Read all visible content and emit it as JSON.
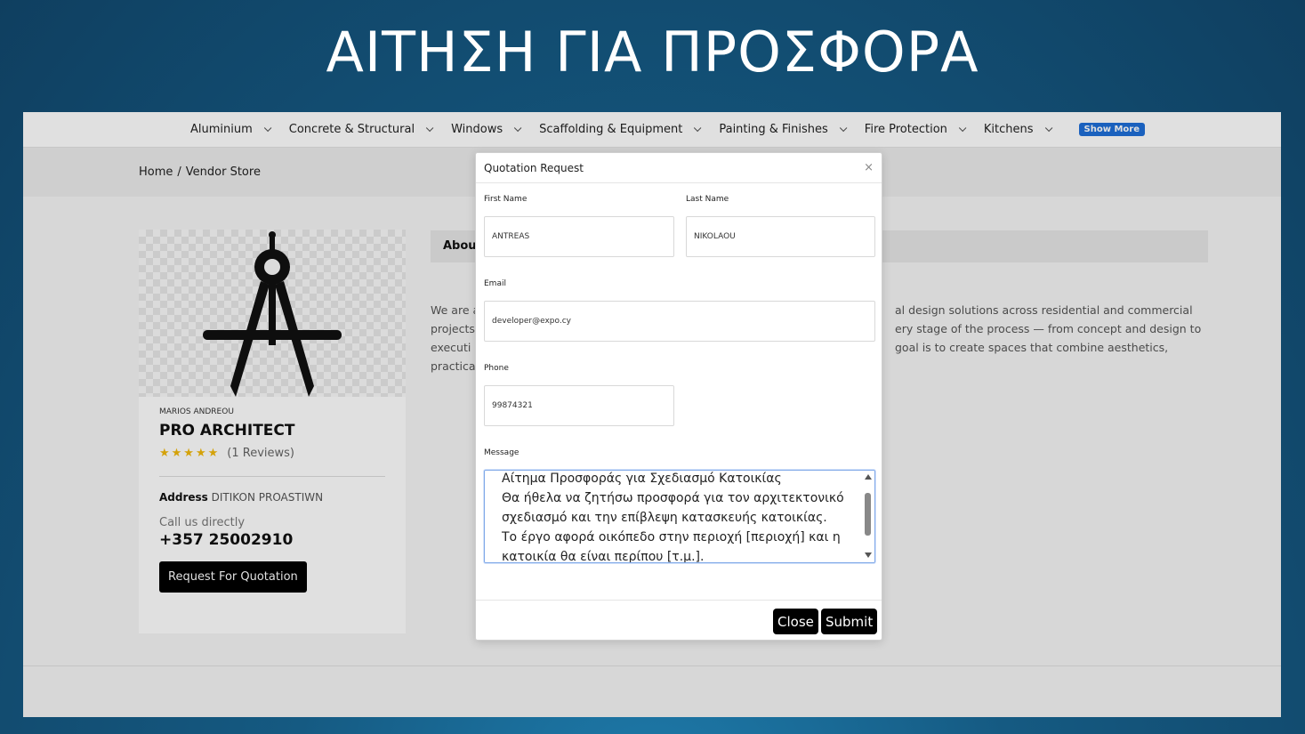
{
  "slide": {
    "title": "ΑΙΤΗΣΗ ΓΙΑ ΠΡΟΣΦΟΡΑ"
  },
  "nav": {
    "items": [
      {
        "label": "Aluminium"
      },
      {
        "label": "Concrete & Structural"
      },
      {
        "label": "Windows"
      },
      {
        "label": "Scaffolding & Equipment"
      },
      {
        "label": "Painting & Finishes"
      },
      {
        "label": "Fire Protection"
      },
      {
        "label": "Kitchens"
      }
    ],
    "show_more": "Show More"
  },
  "breadcrumb": {
    "home": "Home",
    "separator": "/",
    "current": "Vendor Store"
  },
  "vendor": {
    "owner": "MARIOS ANDREOU",
    "name": "PRO ARCHITECT",
    "stars": "★★★★★",
    "reviews": "(1 Reviews)",
    "address_label": "Address",
    "address_value": "DITIKON PROASTIWN",
    "call_label": "Call us directly",
    "phone": "+357 25002910",
    "rfq_button": "Request For Quotation"
  },
  "about": {
    "tab_label": "About",
    "left_lines": [
      "We are a",
      "projects",
      "executi",
      "practica"
    ],
    "right_lines": [
      "al design solutions across residential and commercial",
      "ery stage of the process — from concept and design to",
      "goal is to create spaces that combine aesthetics,"
    ]
  },
  "modal": {
    "title": "Quotation Request",
    "close_x": "×",
    "first_name_label": "First Name",
    "first_name_value": "ANTREAS",
    "last_name_label": "Last Name",
    "last_name_value": "NIKOLAOU",
    "email_label": "Email",
    "email_value": "developer@expo.cy",
    "phone_label": "Phone",
    "phone_value": "99874321",
    "message_label": "Message",
    "message_lines": [
      "Αίτημα Προσφοράς για Σχεδιασμό Κατοικίας",
      "Θα ήθελα να ζητήσω προσφορά για τον αρχιτεκτονικό",
      "σχεδιασμό και την επίβλεψη κατασκευής κατοικίας.",
      "Το έργο αφορά οικόπεδο στην περιοχή [περιοχή] και η",
      "κατοικία θα είναι περίπου [τ.μ.]."
    ],
    "close_button": "Close",
    "submit_button": "Submit"
  },
  "colors": {
    "accent_blue": "#1e6fd9",
    "star_yellow": "#f2b90c",
    "dark_button": "#000000"
  }
}
